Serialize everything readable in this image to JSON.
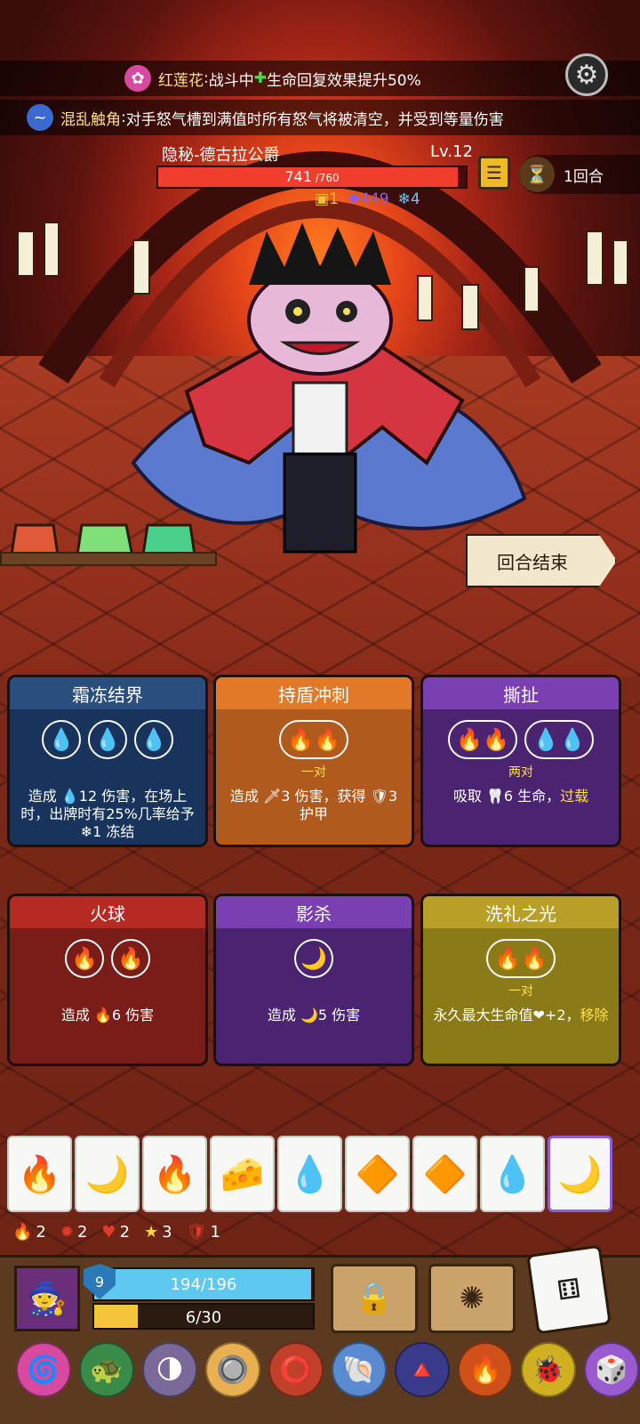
{
  "top_bar": {
    "effect1": {
      "name": "红莲花",
      "colon": ":",
      "text": " 战斗中 ",
      "plus": "✚",
      "text2": "生命回复效果提升50%"
    },
    "effect2": {
      "name": "混乱触角",
      "colon": ":",
      "text": " 对手怒气槽到满值时所有怒气将被清空，并受到等量伤害"
    }
  },
  "boss": {
    "name": "隐秘-德古拉公爵",
    "level": "Lv.12",
    "hp_text": "741",
    "hp_max_text": " /760",
    "hp_fraction": 0.975,
    "status": [
      {
        "icon": "shield",
        "value": "1",
        "color": "#f2c230"
      },
      {
        "icon": "rage",
        "value": "449",
        "color": "#8a5fe0"
      },
      {
        "icon": "snow",
        "value": "4",
        "color": "#6ec6f0"
      }
    ]
  },
  "round": {
    "label": "1回合"
  },
  "end_turn": {
    "label": "回合结束"
  },
  "cards": [
    {
      "title": "霜冻结界",
      "color": "#18345c",
      "header": "#2a4e7e",
      "slots": [
        "💧",
        "💧",
        "💧"
      ],
      "sub": "",
      "desc_parts": [
        "造成 ",
        "💧12",
        " 伤害，在场上时，出牌时有25%几率给予 ",
        "❄1",
        " 冻结"
      ]
    },
    {
      "title": "持盾冲刺",
      "color": "#b05a1e",
      "header": "#e07a28",
      "slots": [
        "🔥🔥"
      ],
      "sub": "一对",
      "desc_parts": [
        "造成 ",
        "🗡3",
        " 伤害，获得 ",
        "🛡3",
        " 护甲"
      ]
    },
    {
      "title": "撕扯",
      "color": "#4a2470",
      "header": "#7a3fb0",
      "slots": [
        "🔥🔥",
        "💧💧"
      ],
      "sub": "两对",
      "desc_parts": [
        "吸取 ",
        "🦷6",
        " 生命，",
        "过载",
        ""
      ]
    },
    {
      "title": "火球",
      "color": "#7a1c18",
      "header": "#b52a22",
      "slots": [
        "🔥",
        "🔥"
      ],
      "sub": "",
      "desc_parts": [
        "造成 ",
        "🔥6",
        " 伤害",
        "",
        ""
      ]
    },
    {
      "title": "影杀",
      "color": "#4a2470",
      "header": "#7a3fb0",
      "slots": [
        "🌙"
      ],
      "sub": "",
      "desc_parts": [
        "造成 ",
        "🌙5",
        " 伤害",
        "",
        ""
      ]
    },
    {
      "title": "洗礼之光",
      "color": "#8a7a18",
      "header": "#b8a028",
      "slots": [
        "🔥🔥"
      ],
      "sub": "一对",
      "desc_parts": [
        "永久最大生命值",
        "❤",
        "+2，",
        "移除",
        ""
      ]
    }
  ],
  "dice": [
    "🔥",
    "🌙",
    "🔥",
    "🧀",
    "💧",
    "🔶",
    "🔶",
    "💧",
    "🌙"
  ],
  "counters": [
    {
      "icon": "🔥",
      "value": "2"
    },
    {
      "icon": "✹",
      "value": "2"
    },
    {
      "icon": "♥",
      "value": "2"
    },
    {
      "icon": "★",
      "value": "3"
    },
    {
      "icon": "🛡",
      "value": "1"
    }
  ],
  "player": {
    "level": "9",
    "hp_text": "194/196",
    "hp_fraction": 0.99,
    "xp_text": "6/30",
    "xp_fraction": 0.2
  },
  "relics": [
    "🌀",
    "🐢",
    "🌗",
    "🔘",
    "⭕",
    "🐚",
    "🔺",
    "🔥",
    "🐞",
    "🎲"
  ],
  "colors": {
    "accent": "#ffdf4a",
    "boss_hp": "#f03d2c",
    "player_hp": "#5ec8f0"
  }
}
